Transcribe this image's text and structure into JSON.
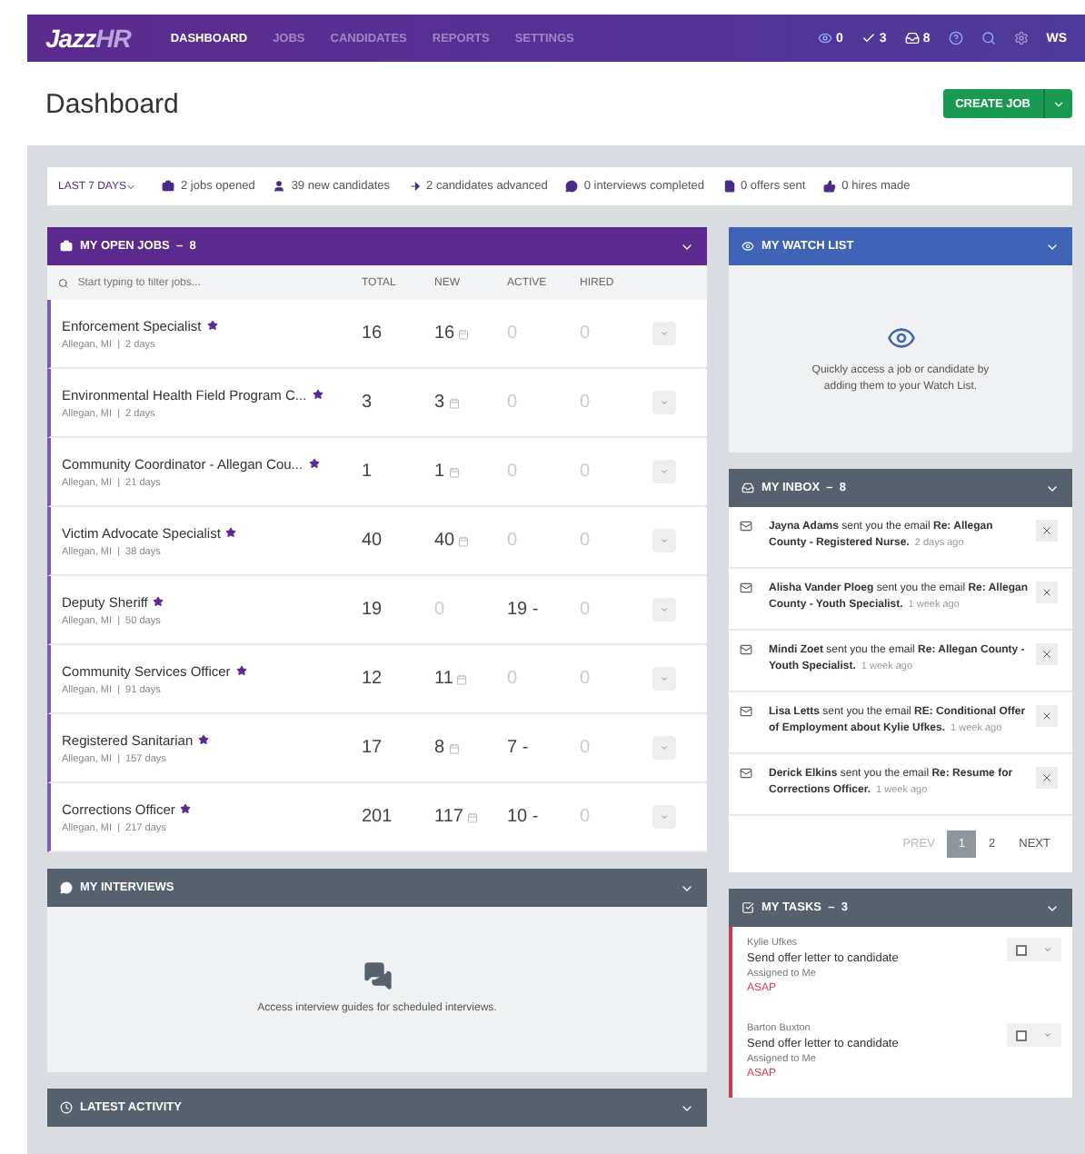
{
  "nav": {
    "logo": {
      "main": "Jazz",
      "accent": "HR"
    },
    "items": [
      {
        "label": "DASHBOARD",
        "selected": true
      },
      {
        "label": "JOBS",
        "selected": false
      },
      {
        "label": "CANDIDATES",
        "selected": false
      },
      {
        "label": "REPORTS",
        "selected": false
      },
      {
        "label": "SETTINGS",
        "selected": false
      }
    ],
    "counters": [
      {
        "kind": "eye",
        "count": "0"
      },
      {
        "kind": "check",
        "count": "3"
      },
      {
        "kind": "inbox",
        "count": "8"
      }
    ],
    "user": "WS"
  },
  "page_title": "Dashboard",
  "create_button": "CREATE JOB",
  "stats": {
    "range": "LAST 7 DAYS",
    "items": [
      {
        "kind": "briefcase",
        "text": "2 jobs opened"
      },
      {
        "kind": "person",
        "text": "39 new candidates"
      },
      {
        "kind": "arrow",
        "text": "2 candidates advanced"
      },
      {
        "kind": "chat",
        "text": "0 interviews completed"
      },
      {
        "kind": "file",
        "text": "0 offers sent"
      },
      {
        "kind": "thumb",
        "text": "0 hires made"
      }
    ]
  },
  "open_jobs": {
    "title": "MY OPEN JOBS  –  8",
    "filter_placeholder": "Start typing to filter jobs...",
    "columns": [
      "TOTAL",
      "NEW",
      "ACTIVE",
      "HIRED"
    ],
    "rows": [
      {
        "title": "Enforcement Specialist",
        "meta": "Allegan, MI  |  2 days",
        "total": "16",
        "new": {
          "text": "16",
          "muted": false
        },
        "active": {
          "text": "0",
          "muted": true
        },
        "hired": {
          "text": "0",
          "muted": true
        }
      },
      {
        "title": "Environmental Health Field Program C...",
        "meta": "Allegan, MI  |  2 days",
        "total": "3",
        "new": {
          "text": "3",
          "muted": false
        },
        "active": {
          "text": "0",
          "muted": true
        },
        "hired": {
          "text": "0",
          "muted": true
        }
      },
      {
        "title": "Community Coordinator - Allegan Cou...",
        "meta": "Allegan, MI  |  21 days",
        "total": "1",
        "new": {
          "text": "1",
          "muted": false
        },
        "active": {
          "text": "0",
          "muted": true
        },
        "hired": {
          "text": "0",
          "muted": true
        }
      },
      {
        "title": "Victim Advocate Specialist",
        "meta": "Allegan, MI  |  38 days",
        "total": "40",
        "new": {
          "text": "40",
          "muted": false
        },
        "active": {
          "text": "0",
          "muted": true
        },
        "hired": {
          "text": "0",
          "muted": true
        }
      },
      {
        "title": "Deputy Sheriff",
        "meta": "Allegan, MI  |  50 days",
        "total": "19",
        "new": {
          "text": "0",
          "muted": true
        },
        "active": {
          "text": "19 -",
          "muted": false
        },
        "hired": {
          "text": "0",
          "muted": true
        }
      },
      {
        "title": "Community Services Officer",
        "meta": "Allegan, MI  |  91 days",
        "total": "12",
        "new": {
          "text": "11",
          "muted": false
        },
        "active": {
          "text": "0",
          "muted": true
        },
        "hired": {
          "text": "0",
          "muted": true
        }
      },
      {
        "title": "Registered Sanitarian",
        "meta": "Allegan, MI  |  157 days",
        "total": "17",
        "new": {
          "text": "8",
          "muted": false
        },
        "active": {
          "text": "7 -",
          "muted": false
        },
        "hired": {
          "text": "0",
          "muted": true
        }
      },
      {
        "title": "Corrections Officer",
        "meta": "Allegan, MI  |  217 days",
        "total": "201",
        "new": {
          "text": "117",
          "muted": false
        },
        "active": {
          "text": "10 -",
          "muted": false
        },
        "hired": {
          "text": "0",
          "muted": true
        }
      }
    ]
  },
  "interviews": {
    "title": "MY INTERVIEWS",
    "empty_text": "Access interview guides for scheduled interviews."
  },
  "latest_activity": {
    "title": "LATEST ACTIVITY"
  },
  "watch_list": {
    "title": "MY WATCH LIST",
    "empty_text": "Quickly access a job or candidate by adding them to your Watch List."
  },
  "inbox": {
    "title": "MY INBOX  –  8",
    "items": [
      {
        "text": "**Jayna Adams** sent you the email **Re: Allegan County - Registered Nurse.**",
        "time": "2 days ago"
      },
      {
        "text": "**Alisha Vander Ploeg** sent you the email **Re: Allegan County - Youth Specialist.**",
        "time": "1 week ago"
      },
      {
        "text": "**Mindi Zoet** sent you the email **Re: Allegan County - Youth Specialist.**",
        "time": "1 week ago"
      },
      {
        "text": "**Lisa Letts** sent you the email **RE: Conditional Offer of Employment about Kylie Ufkes.**",
        "time": "1 week ago"
      },
      {
        "text": "**Derick Elkins** sent you the email **Re: Resume for Corrections Officer.**",
        "time": "1 week ago"
      }
    ],
    "pagination": {
      "prev": "PREV",
      "pages": [
        {
          "label": "1",
          "selected": true
        },
        {
          "label": "2",
          "selected": false
        }
      ],
      "next": "NEXT"
    }
  },
  "tasks": {
    "title": "MY TASKS  –  3",
    "items": [
      {
        "person": "Kylie Ufkes",
        "title": "Send offer letter to candidate",
        "assigned": "Assigned to Me",
        "due": "ASAP",
        "checked": false
      },
      {
        "person": "Barton Buxton",
        "title": "Send offer letter to candidate",
        "assigned": "Assigned to Me",
        "due": "ASAP",
        "checked": false
      }
    ]
  }
}
